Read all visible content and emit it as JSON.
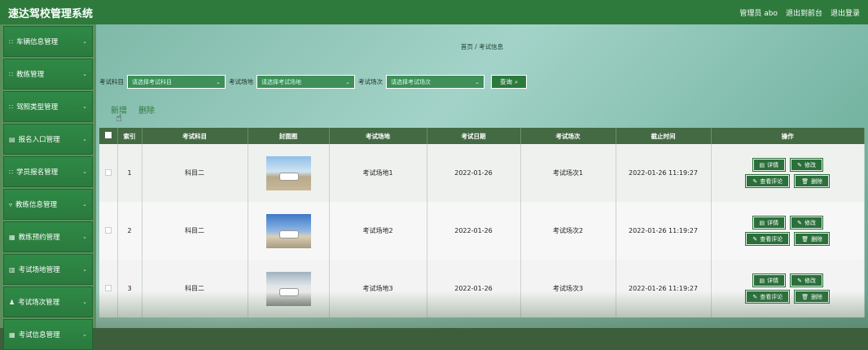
{
  "app_title": "速达驾校管理系统",
  "top_links": {
    "admin": "管理员 abo",
    "front": "退出到前台",
    "logout": "退出登录"
  },
  "sidebar": {
    "items": [
      {
        "icon": "grid-icon",
        "label": "车辆信息管理"
      },
      {
        "icon": "grid-icon",
        "label": "教练管理"
      },
      {
        "icon": "grid-icon",
        "label": "驾照类型管理"
      },
      {
        "icon": "doc-icon",
        "label": "报名入口管理"
      },
      {
        "icon": "grid-icon",
        "label": "学员报名管理"
      },
      {
        "icon": "filter-icon",
        "label": "教练信息管理"
      },
      {
        "icon": "table-icon",
        "label": "教练预约管理"
      },
      {
        "icon": "bar-chart-icon",
        "label": "考试场地管理"
      },
      {
        "icon": "person-icon",
        "label": "考试场次管理"
      },
      {
        "icon": "table-icon",
        "label": "考试信息管理"
      }
    ]
  },
  "breadcrumb": {
    "home": "首页",
    "sep": "/",
    "current": "考试信息"
  },
  "filters": {
    "subject_label": "考试科目",
    "subject_placeholder": "请选择考试科目",
    "venue_label": "考试场地",
    "venue_placeholder": "请选择考试场地",
    "session_label": "考试场次",
    "session_placeholder": "请选择考试场次",
    "query_label": "查询"
  },
  "actions": {
    "add": "新增",
    "delete": "删除"
  },
  "table": {
    "headers": [
      "索引",
      "考试科目",
      "封面图",
      "考试场地",
      "考试日期",
      "考试场次",
      "截止时间",
      "操作"
    ],
    "rows": [
      {
        "index": "1",
        "subject": "科目二",
        "venue": "考试场地1",
        "date": "2022-01-26",
        "session": "考试场次1",
        "deadline": "2022-01-26 11:19:27"
      },
      {
        "index": "2",
        "subject": "科目二",
        "venue": "考试场地2",
        "date": "2022-01-26",
        "session": "考试场次2",
        "deadline": "2022-01-26 11:19:27"
      },
      {
        "index": "3",
        "subject": "科目二",
        "venue": "考试场地3",
        "date": "2022-01-26",
        "session": "考试场次3",
        "deadline": "2022-01-26 11:19:27"
      }
    ],
    "ops": {
      "detail": "详情",
      "edit": "修改",
      "review": "查看评论",
      "remove": "删除"
    }
  }
}
